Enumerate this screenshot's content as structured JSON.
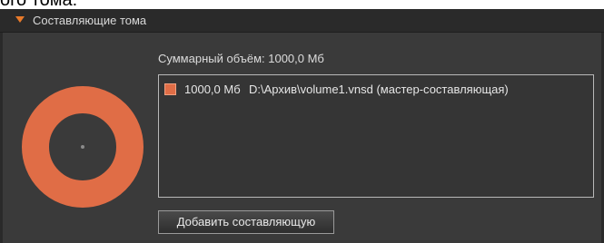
{
  "top_strip_text": "ого тома:",
  "header": {
    "title": "Составляющие тома"
  },
  "volume": {
    "total_label": "Суммарный объём: 1000,0 Мб",
    "components": [
      {
        "size": "1000,0 Мб",
        "path": "D:\\Архив\\volume1.vnsd (мастер-составляющая)",
        "color": "#e06d46"
      }
    ],
    "add_button_label": "Добавить составляющую"
  },
  "colors": {
    "panel_bg": "#3a3a3a",
    "header_bg": "#2a2a2a",
    "accent": "#e87a2a",
    "donut": "#e06d46"
  }
}
